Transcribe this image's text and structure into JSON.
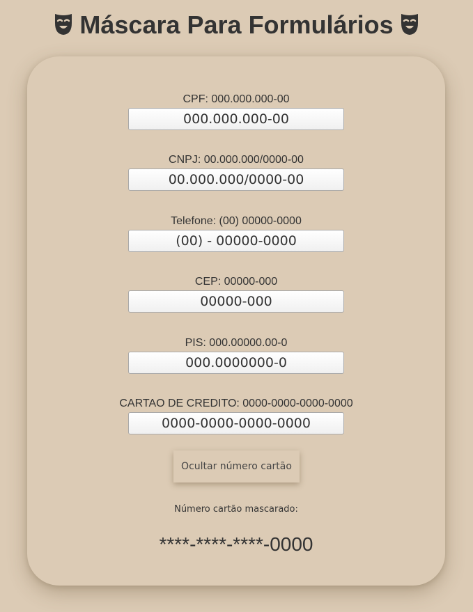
{
  "page": {
    "title": "Máscara Para Formulários",
    "title_icon": "theater-mask-icon"
  },
  "fields": [
    {
      "id": "cpf",
      "label": "CPF: 000.000.000-00",
      "value": "000.000.000-00"
    },
    {
      "id": "cnpj",
      "label": "CNPJ: 00.000.000/0000-00",
      "value": "00.000.000/0000-00"
    },
    {
      "id": "telefone",
      "label": "Telefone: (00) 00000-0000",
      "value": "(00) - 00000-0000"
    },
    {
      "id": "cep",
      "label": "CEP: 00000-000",
      "value": "00000-000"
    },
    {
      "id": "pis",
      "label": "PIS: 000.00000.00-0",
      "value": "000.0000000-0"
    },
    {
      "id": "cartao",
      "label": "CARTAO DE CREDITO: 0000-0000-0000-0000",
      "value": "0000-0000-0000-0000"
    }
  ],
  "toggle_button_label": "Ocultar número cartão",
  "masked": {
    "label": "Número cartão mascarado:",
    "value": "****-****-****-0000"
  },
  "colors": {
    "background": "#dccbb5",
    "text": "#333333"
  }
}
